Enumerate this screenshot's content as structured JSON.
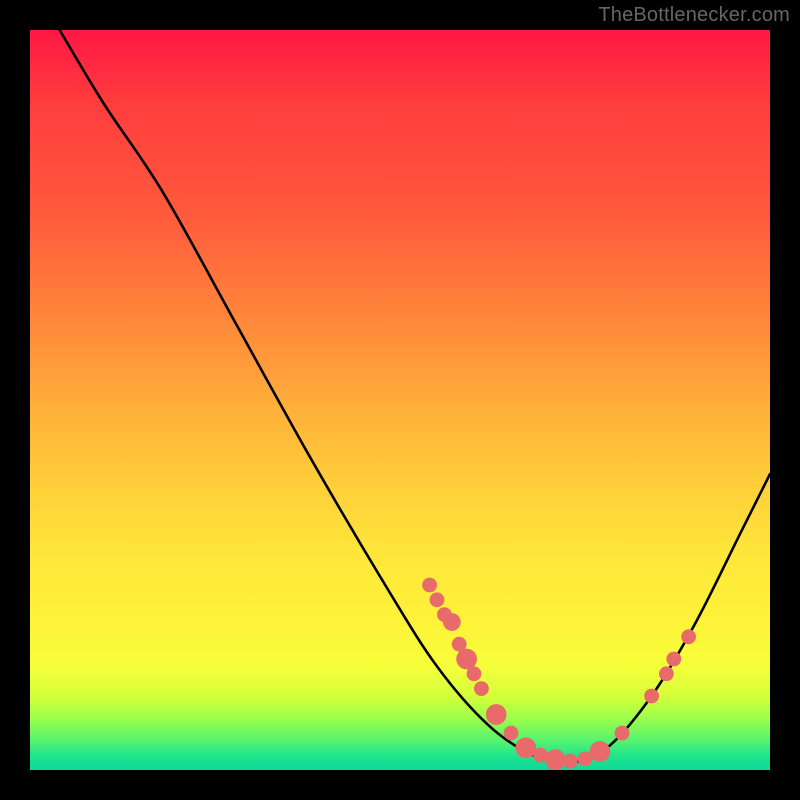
{
  "source_label": "TheBottlenecker.com",
  "chart_data": {
    "type": "line",
    "title": "",
    "xlabel": "",
    "ylabel": "",
    "xlim": [
      0,
      100
    ],
    "ylim": [
      0,
      100
    ],
    "grid": false,
    "legend": false,
    "series": [
      {
        "name": "bottleneck-curve",
        "color": "#000000",
        "points": [
          {
            "x": 4,
            "y": 100
          },
          {
            "x": 10,
            "y": 90
          },
          {
            "x": 18,
            "y": 78
          },
          {
            "x": 28,
            "y": 60
          },
          {
            "x": 38,
            "y": 42
          },
          {
            "x": 48,
            "y": 25
          },
          {
            "x": 55,
            "y": 14
          },
          {
            "x": 62,
            "y": 6
          },
          {
            "x": 68,
            "y": 2
          },
          {
            "x": 73,
            "y": 1
          },
          {
            "x": 78,
            "y": 3
          },
          {
            "x": 84,
            "y": 10
          },
          {
            "x": 90,
            "y": 20
          },
          {
            "x": 96,
            "y": 32
          },
          {
            "x": 100,
            "y": 40
          }
        ]
      }
    ],
    "markers": [
      {
        "x": 54,
        "y": 25,
        "r": 1.0
      },
      {
        "x": 55,
        "y": 23,
        "r": 1.0
      },
      {
        "x": 56,
        "y": 21,
        "r": 1.0
      },
      {
        "x": 57,
        "y": 20,
        "r": 1.2
      },
      {
        "x": 58,
        "y": 17,
        "r": 1.0
      },
      {
        "x": 59,
        "y": 15,
        "r": 1.4
      },
      {
        "x": 60,
        "y": 13,
        "r": 1.0
      },
      {
        "x": 61,
        "y": 11,
        "r": 1.0
      },
      {
        "x": 63,
        "y": 7.5,
        "r": 1.4
      },
      {
        "x": 65,
        "y": 5,
        "r": 1.0
      },
      {
        "x": 67,
        "y": 3,
        "r": 1.4
      },
      {
        "x": 69,
        "y": 2,
        "r": 1.0
      },
      {
        "x": 71,
        "y": 1.4,
        "r": 1.4
      },
      {
        "x": 73,
        "y": 1.2,
        "r": 1.0
      },
      {
        "x": 75,
        "y": 1.5,
        "r": 1.0
      },
      {
        "x": 77,
        "y": 2.5,
        "r": 1.4
      },
      {
        "x": 80,
        "y": 5,
        "r": 1.0
      },
      {
        "x": 84,
        "y": 10,
        "r": 1.0
      },
      {
        "x": 86,
        "y": 13,
        "r": 1.0
      },
      {
        "x": 87,
        "y": 15,
        "r": 1.0
      },
      {
        "x": 89,
        "y": 18,
        "r": 1.0
      }
    ],
    "marker_color": "#e86a6a"
  }
}
